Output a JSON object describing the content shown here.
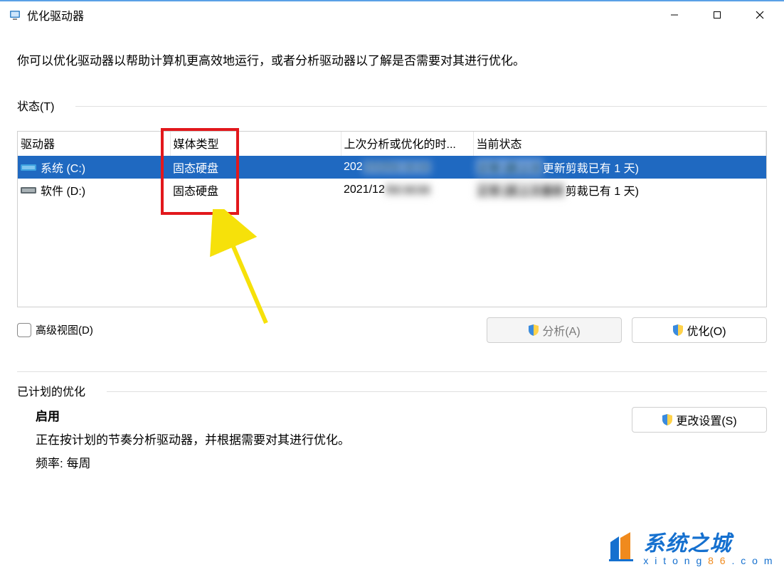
{
  "window": {
    "title": "优化驱动器"
  },
  "description": "你可以优化驱动器以帮助计算机更高效地运行，或者分析驱动器以了解是否需要对其进行优化。",
  "status": {
    "label": "状态(T)",
    "columns": {
      "drive": "驱动器",
      "media": "媒体类型",
      "last": "上次分析或优化的时...",
      "state": "当前状态"
    },
    "rows": [
      {
        "selected": true,
        "drive_icon": "ssd",
        "drive_label": "系统 (C:)",
        "media": "固态硬盘",
        "last_prefix": "202",
        "last_blur": "1/12/xx xx:xx",
        "state_blur": "正常 (距上次",
        "state_suffix": "更新剪裁已有 1 天)"
      },
      {
        "selected": false,
        "drive_icon": "ssd",
        "drive_label": "软件 (D:)",
        "media": "固态硬盘",
        "last_prefix": "2021/12",
        "last_blur": "/xx xx:xx",
        "state_blur": "正常 (距上次重新",
        "state_suffix": "剪裁已有 1 天)"
      }
    ]
  },
  "below": {
    "advanced_view": "高级视图(D)",
    "analyze": "分析(A)",
    "optimize": "优化(O)"
  },
  "schedule": {
    "section_label": "已计划的优化",
    "enabled_title": "启用",
    "line1": "正在按计划的节奏分析驱动器，并根据需要对其进行优化。",
    "line2": "频率: 每周",
    "change_settings": "更改设置(S)"
  },
  "watermark": {
    "title": "系统之城",
    "url_before": "x i t o n g ",
    "url_mid": "8 6",
    "url_after": " . c o m"
  }
}
